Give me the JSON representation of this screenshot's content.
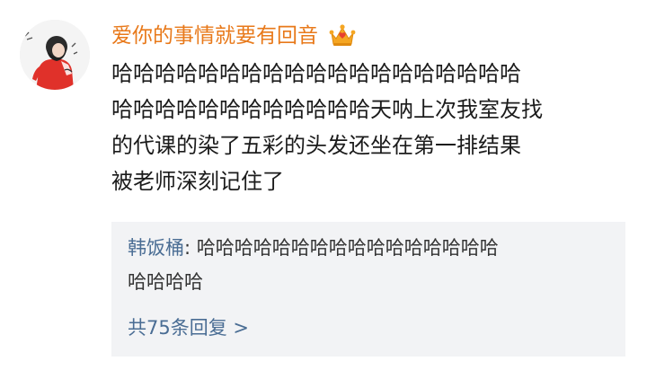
{
  "comment": {
    "username": "爱你的事情就要有回音",
    "badge_icon": "crown-icon",
    "content_lines": [
      "哈哈哈哈哈哈哈哈哈哈哈哈哈哈哈哈哈哈哈",
      "哈哈哈哈哈哈哈哈哈哈哈哈天呐上次我室友找",
      "的代课的染了五彩的头发还坐在第一排结果",
      "被老师深刻记住了"
    ]
  },
  "replies": {
    "items": [
      {
        "author": "韩饭桶",
        "separator": ": ",
        "text_line1": "哈哈哈哈哈哈哈哈哈哈哈哈哈哈哈哈",
        "text_line2": "哈哈哈哈"
      }
    ],
    "more_label": "共75条回复 >"
  },
  "colors": {
    "username": "#e8791a",
    "link": "#4a6d94",
    "reply_background": "#f2f3f5",
    "text": "#1b1b1b"
  }
}
